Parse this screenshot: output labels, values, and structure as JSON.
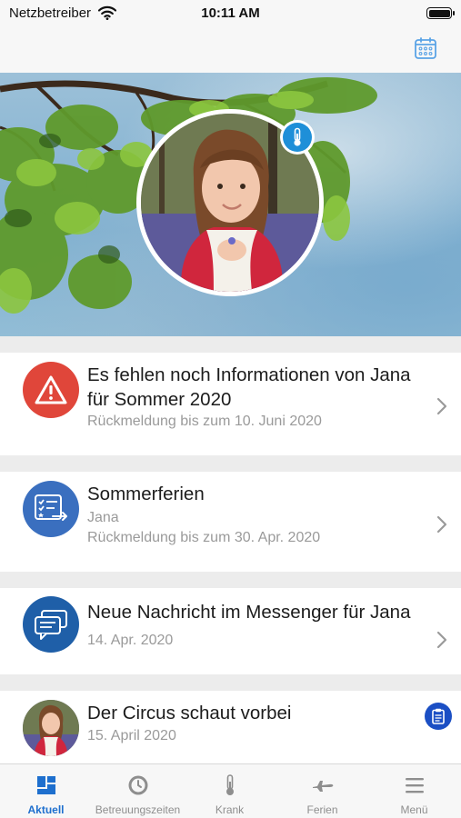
{
  "status_bar": {
    "carrier": "Netzbetreiber",
    "time": "10:11 AM"
  },
  "colors": {
    "accent": "#1e6fce",
    "alert": "#e0463a",
    "card_blue": "#3a6fbf",
    "messenger_blue": "#1f5fa8"
  },
  "hero": {
    "badge_icon": "thermometer-icon"
  },
  "cards": [
    {
      "icon": "warning-icon",
      "title": "Es fehlen noch Informationen von Jana für Sommer 2020",
      "subtitle": "Rückmeldung bis zum 10. Juni 2020"
    },
    {
      "icon": "checklist-icon",
      "title": "Sommerferien",
      "subtitle_1": "Jana",
      "subtitle_2": "Rückmeldung bis zum 30. Apr. 2020"
    },
    {
      "icon": "chat-icon",
      "title": "Neue Nachricht im Messenger für Jana",
      "subtitle": "14. Apr. 2020"
    },
    {
      "icon": "clipboard-icon",
      "title": "Der Circus schaut vorbei",
      "subtitle": "15. April 2020"
    }
  ],
  "tabs": [
    {
      "label": "Aktuell",
      "icon": "dashboard-icon",
      "active": true
    },
    {
      "label": "Betreuungszeiten",
      "icon": "clock-icon",
      "active": false
    },
    {
      "label": "Krank",
      "icon": "thermometer-icon",
      "active": false
    },
    {
      "label": "Ferien",
      "icon": "airplane-icon",
      "active": false
    },
    {
      "label": "Menü",
      "icon": "hamburger-icon",
      "active": false
    }
  ]
}
